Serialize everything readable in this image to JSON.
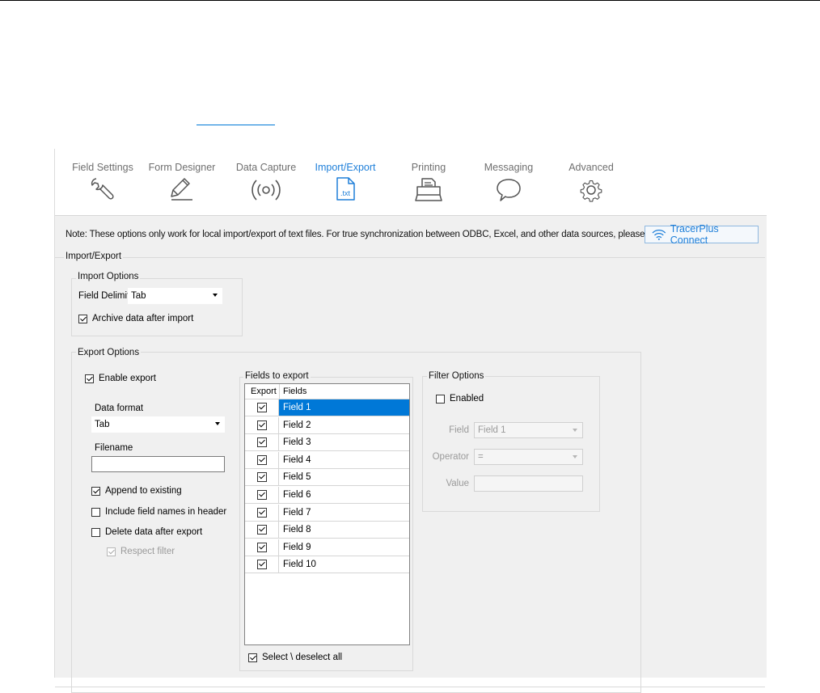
{
  "tabs": [
    {
      "label": "Field Settings",
      "icon": "wrench-icon",
      "active": false
    },
    {
      "label": "Form Designer",
      "icon": "pencil-icon",
      "active": false
    },
    {
      "label": "Data Capture",
      "icon": "broadcast-icon",
      "active": false
    },
    {
      "label": "Import/Export",
      "icon": "txt-file-icon",
      "active": true,
      "icon_text": ".txt"
    },
    {
      "label": "Printing",
      "icon": "printer-icon",
      "active": false
    },
    {
      "label": "Messaging",
      "icon": "speech-bubble-icon",
      "active": false
    },
    {
      "label": "Advanced",
      "icon": "gear-icon",
      "active": false
    }
  ],
  "note": "Note: These options only work for local import/export of text files. For true synchronization between ODBC, Excel, and other data sources, please use",
  "tracerplus_button": "TracerPlus Connect",
  "import_export_group": "Import/Export",
  "import_options": {
    "title": "Import Options",
    "field_delimiter_label": "Field Delimiter",
    "field_delimiter_value": "Tab",
    "archive_label": "Archive data after import",
    "archive_checked": true
  },
  "export_options": {
    "title": "Export Options",
    "enable_export_label": "Enable export",
    "enable_export_checked": true,
    "data_format_label": "Data format",
    "data_format_value": "Tab",
    "filename_label": "Filename",
    "filename_value": "",
    "append_label": "Append to existing",
    "append_checked": true,
    "include_names_label": "Include field names in header",
    "include_names_checked": false,
    "delete_after_label": "Delete data after export",
    "delete_after_checked": false,
    "respect_filter_label": "Respect filter",
    "respect_filter_checked": true
  },
  "fields_to_export": {
    "title": "Fields to export",
    "columns": [
      "Export",
      "Fields"
    ],
    "rows": [
      {
        "name": "Field 1",
        "checked": true,
        "selected": true
      },
      {
        "name": "Field 2",
        "checked": true
      },
      {
        "name": "Field 3",
        "checked": true
      },
      {
        "name": "Field 4",
        "checked": true
      },
      {
        "name": "Field 5",
        "checked": true
      },
      {
        "name": "Field 6",
        "checked": true
      },
      {
        "name": "Field 7",
        "checked": true
      },
      {
        "name": "Field 8",
        "checked": true
      },
      {
        "name": "Field 9",
        "checked": true
      },
      {
        "name": "Field 10",
        "checked": true
      }
    ],
    "select_all_label": "Select \\ deselect all",
    "select_all_checked": true
  },
  "filter_options": {
    "title": "Filter Options",
    "enabled_label": "Enabled",
    "enabled_checked": false,
    "field_label": "Field",
    "field_value": "Field 1",
    "operator_label": "Operator",
    "operator_value": "=",
    "value_label": "Value",
    "value_value": ""
  },
  "colors": {
    "accent": "#1e7fd9",
    "selection": "#0078d7",
    "panel_bg": "#f0f0f0"
  }
}
